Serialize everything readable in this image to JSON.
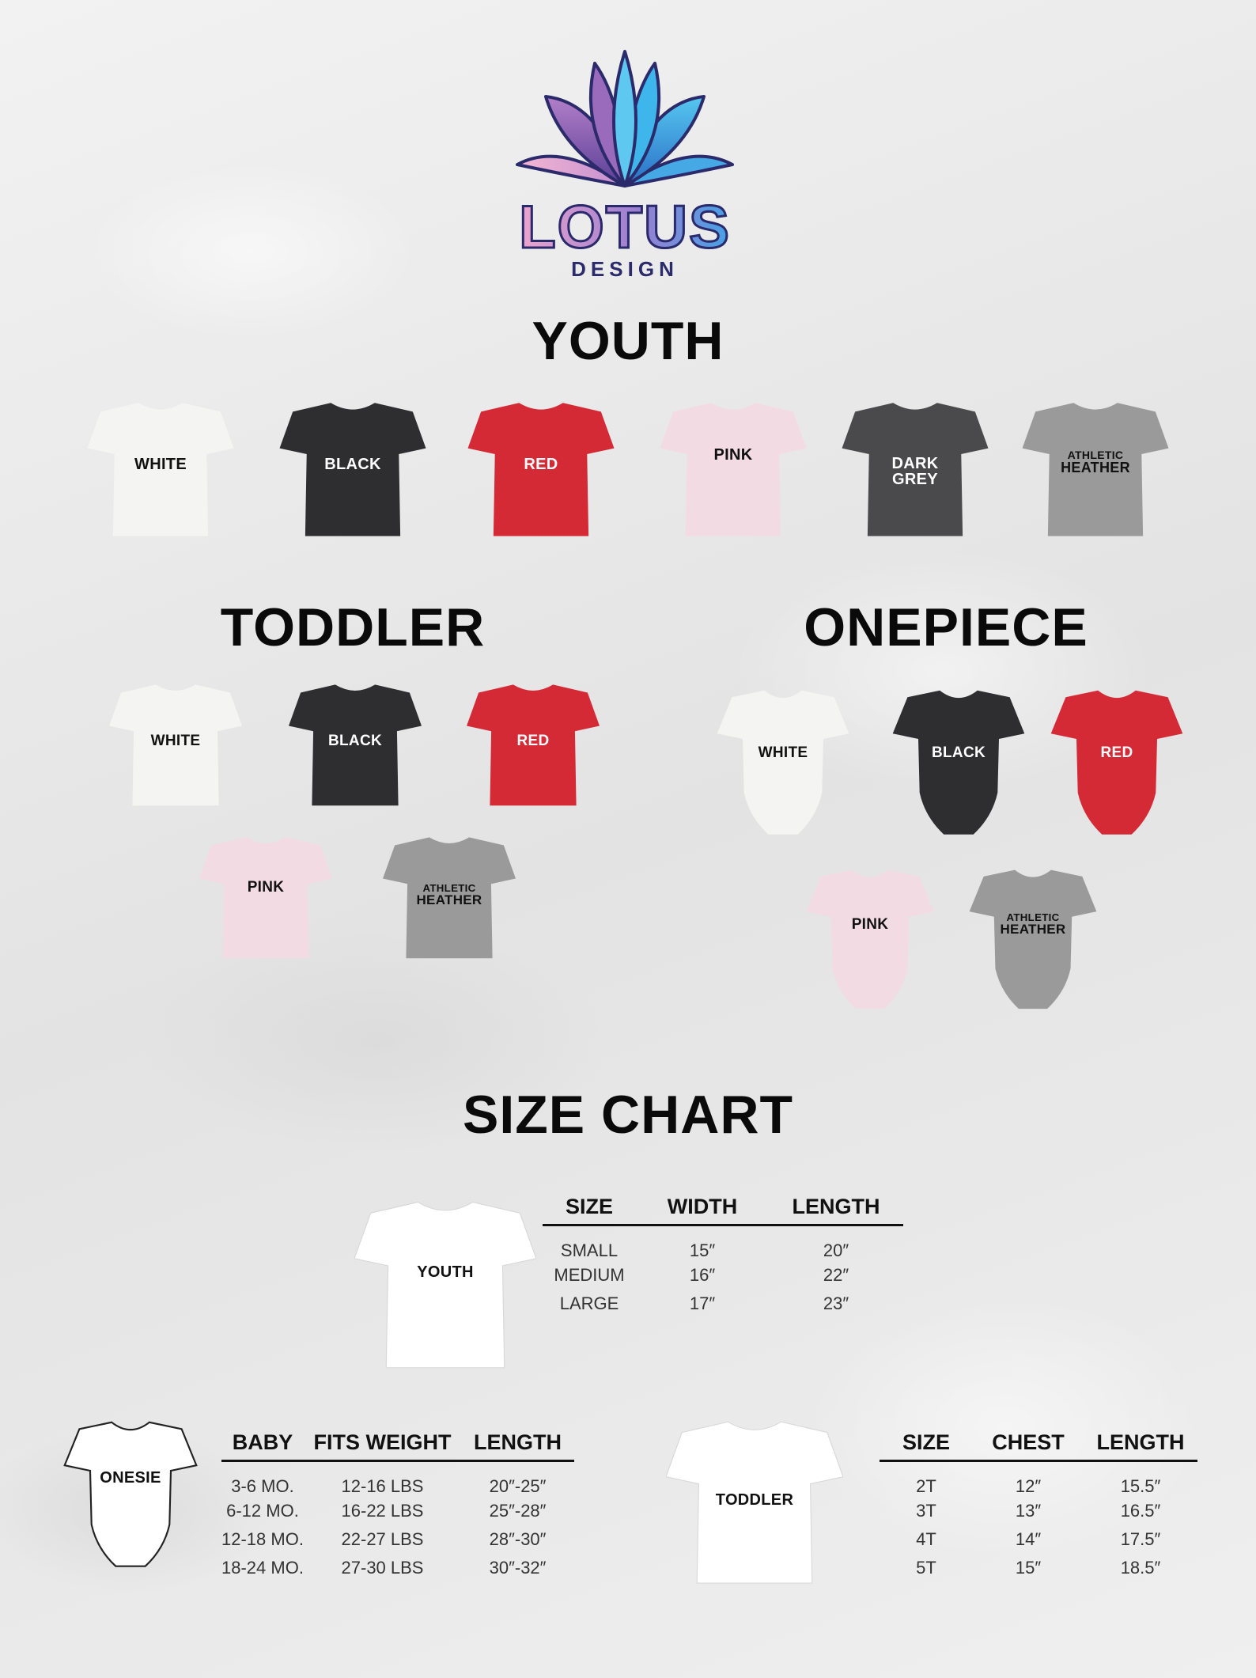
{
  "brand": {
    "name": "LOTUS",
    "tagline": "DESIGN"
  },
  "sections": {
    "youth": "YOUTH",
    "toddler": "TODDLER",
    "onepiece": "ONEPIECE",
    "size_chart": "SIZE CHART"
  },
  "colors": {
    "white": "#f4f4f2",
    "black": "#2e2e30",
    "red": "#d42a36",
    "pink": "#f3dbe3",
    "dark_grey": "#4a4a4c",
    "athletic_heather": "#9a9a9a"
  },
  "youth_shirts": [
    {
      "label": "WHITE"
    },
    {
      "label": "BLACK"
    },
    {
      "label": "RED"
    },
    {
      "label": "PINK"
    },
    {
      "label_line1": "DARK",
      "label_line2": "GREY"
    },
    {
      "label_line1": "ATHLETIC",
      "label_line2": "HEATHER"
    }
  ],
  "toddler_shirts": [
    {
      "label": "WHITE"
    },
    {
      "label": "BLACK"
    },
    {
      "label": "RED"
    },
    {
      "label": "PINK"
    },
    {
      "label_line1": "ATHLETIC",
      "label_line2": "HEATHER"
    }
  ],
  "onepiece": [
    {
      "label": "WHITE"
    },
    {
      "label": "BLACK"
    },
    {
      "label": "RED"
    },
    {
      "label": "PINK"
    },
    {
      "label_line1": "ATHLETIC",
      "label_line2": "HEATHER"
    }
  ],
  "youth_chart": {
    "figure_label": "YOUTH",
    "headers": [
      "SIZE",
      "WIDTH",
      "LENGTH"
    ],
    "rows": [
      [
        "SMALL",
        "15″",
        "20″"
      ],
      [
        "MEDIUM",
        "16″",
        "22″"
      ],
      [
        "LARGE",
        "17″",
        "23″"
      ]
    ]
  },
  "baby_chart": {
    "figure_label": "ONESIE",
    "headers": [
      "BABY",
      "FITS WEIGHT",
      "LENGTH"
    ],
    "rows": [
      [
        "3-6 MO.",
        "12-16 LBS",
        "20″-25″"
      ],
      [
        "6-12 MO.",
        "16-22 LBS",
        "25″-28″"
      ],
      [
        "12-18 MO.",
        "22-27 LBS",
        "28″-30″"
      ],
      [
        "18-24 MO.",
        "27-30 LBS",
        "30″-32″"
      ]
    ]
  },
  "toddler_chart": {
    "figure_label": "TODDLER",
    "headers": [
      "SIZE",
      "CHEST",
      "LENGTH"
    ],
    "rows": [
      [
        "2T",
        "12″",
        "15.5″"
      ],
      [
        "3T",
        "13″",
        "16.5″"
      ],
      [
        "4T",
        "14″",
        "17.5″"
      ],
      [
        "5T",
        "15″",
        "18.5″"
      ]
    ]
  }
}
